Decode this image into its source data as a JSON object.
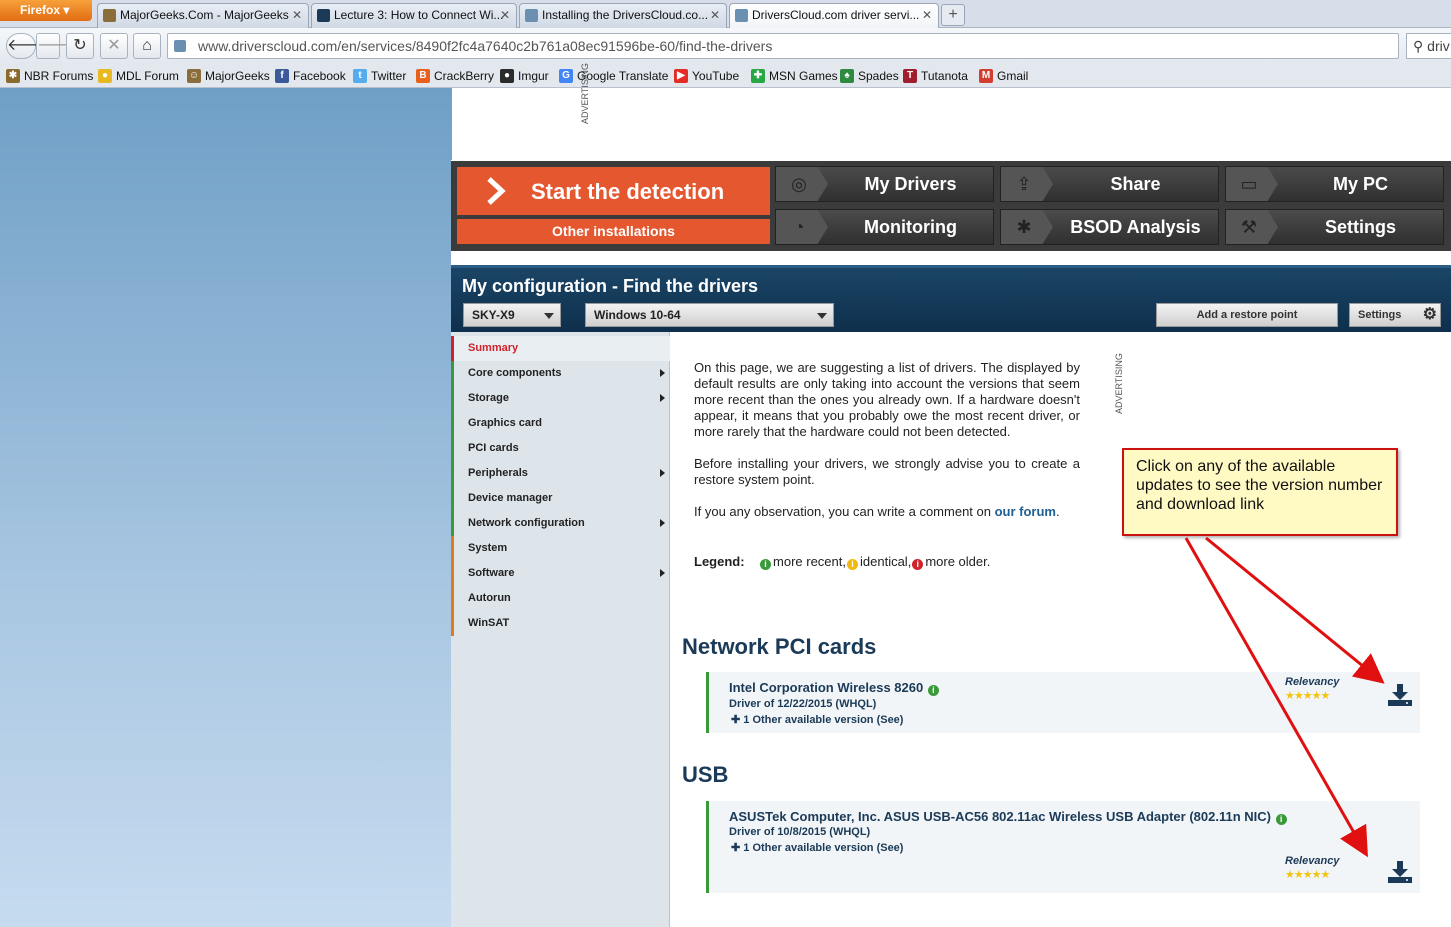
{
  "browser": {
    "menu_button": "Firefox",
    "tabs": [
      {
        "title": "MajorGeeks.Com - MajorGeeks",
        "fav_color": "#8a6d3b"
      },
      {
        "title": "Lecture 3: How to Connect Wi...",
        "fav_color": "#1b3a57"
      },
      {
        "title": "Installing the DriversCloud.co...",
        "fav_color": "#6a8fb0"
      },
      {
        "title": "DriversCloud.com driver servi...",
        "fav_color": "#6a8fb0"
      }
    ],
    "new_tab": "+",
    "url": "www.driverscloud.com/en/services/8490f2fc4a7640c2b761a08ec91596be-60/find-the-drivers",
    "search_text": "driv",
    "bookmarks": [
      {
        "label": "NBR Forums",
        "color": "#8b6b2a",
        "glyph": "✱"
      },
      {
        "label": "MDL Forum",
        "color": "#e8b923",
        "glyph": "●"
      },
      {
        "label": "MajorGeeks",
        "color": "#8a6d3b",
        "glyph": "☺"
      },
      {
        "label": "Facebook",
        "color": "#3b5998",
        "glyph": "f"
      },
      {
        "label": "Twitter",
        "color": "#55acee",
        "glyph": "t"
      },
      {
        "label": "CrackBerry",
        "color": "#e8601c",
        "glyph": "B"
      },
      {
        "label": "Imgur",
        "color": "#2b2b2b",
        "glyph": "●"
      },
      {
        "label": "Google Translate",
        "color": "#4285f4",
        "glyph": "G"
      },
      {
        "label": "YouTube",
        "color": "#e52d27",
        "glyph": "▶"
      },
      {
        "label": "MSN Games",
        "color": "#27a844",
        "glyph": "✚"
      },
      {
        "label": "Spades",
        "color": "#2d8a3e",
        "glyph": "♠"
      },
      {
        "label": "Tutanota",
        "color": "#a01e2e",
        "glyph": "T"
      },
      {
        "label": "Gmail",
        "color": "#d23f31",
        "glyph": "M"
      }
    ]
  },
  "ad_top_label": "ADVERTISING",
  "menu": {
    "detect_label": "Start the detection",
    "other_label": "Other installations",
    "buttons": [
      {
        "label": "My Drivers",
        "icon": "disc-icon"
      },
      {
        "label": "Share",
        "icon": "upload-box-icon"
      },
      {
        "label": "My PC",
        "icon": "monitor-icon"
      },
      {
        "label": "Monitoring",
        "icon": "gauge-icon"
      },
      {
        "label": "BSOD Analysis",
        "icon": "bug-icon"
      },
      {
        "label": "Settings",
        "icon": "wrench-icon"
      }
    ]
  },
  "config": {
    "title": "My configuration - Find the drivers",
    "machine": "SKY-X9",
    "os": "Windows 10-64",
    "restore_label": "Add a restore point",
    "settings_label": "Settings"
  },
  "sidebar": {
    "items": [
      {
        "label": "Summary",
        "active": true,
        "sub": false,
        "bar": "#d0222a"
      },
      {
        "label": "Core components",
        "sub": true,
        "bar": "#3a9a3a"
      },
      {
        "label": "Storage",
        "sub": true,
        "bar": "#3a9a3a"
      },
      {
        "label": "Graphics card",
        "sub": false,
        "bar": "#3a9a3a"
      },
      {
        "label": "PCI cards",
        "sub": false,
        "bar": "#3a9a3a"
      },
      {
        "label": "Peripherals",
        "sub": true,
        "bar": "#3a9a3a"
      },
      {
        "label": "Device manager",
        "sub": false,
        "bar": "#3a9a3a"
      },
      {
        "label": "Network configuration",
        "sub": true,
        "bar": "#3a9a3a"
      },
      {
        "label": "System",
        "sub": false,
        "bar": "#e07a1f"
      },
      {
        "label": "Software",
        "sub": true,
        "bar": "#e07a1f"
      },
      {
        "label": "Autorun",
        "sub": false,
        "bar": "#e07a1f"
      },
      {
        "label": "WinSAT",
        "sub": false,
        "bar": "#e07a1f"
      }
    ]
  },
  "content": {
    "intro_p1": "On this page, we are suggesting a list of drivers. The displayed by default results are only taking into account the versions that seem more recent than the ones you already own. If a hardware doesn't appear, it means that you probably owe the most recent driver, or more rarely that the hardware could not been detected.",
    "intro_p2": "Before installing your drivers, we strongly advise you to create a restore system point.",
    "intro_p3_before": "If you any observation, you can write a comment on ",
    "intro_p3_link": "our forum",
    "intro_p3_after": ".",
    "legend_label": "Legend:",
    "legend_recent": "more recent,",
    "legend_identical": "identical,",
    "legend_older": "more older.",
    "advertising_side": "ADVERTISING"
  },
  "sections": [
    {
      "title": "Network PCI cards",
      "driver": {
        "name": "Intel Corporation Wireless 8260",
        "date": "Driver of 12/22/2015 (WHQL)",
        "more": "1 Other available version (See)",
        "relevancy": "Relevancy",
        "stars": 5
      }
    },
    {
      "title": "USB",
      "driver": {
        "name": "ASUSTek Computer, Inc. ASUS USB-AC56 802.11ac Wireless USB Adapter (802.11n NIC)",
        "date": "Driver of 10/8/2015 (WHQL)",
        "more": "1 Other available version (See)",
        "relevancy": "Relevancy",
        "stars": 5
      }
    }
  ],
  "callout": {
    "text": "Click on any of the available updates to see the version number and download link"
  },
  "colors": {
    "accent_orange": "#e5572f",
    "header_blue": "#0e2f4c",
    "green_info": "#3a9a3a",
    "yellow_info": "#f1b90f",
    "red_info": "#d0222a",
    "arrow_red": "#e01010"
  }
}
